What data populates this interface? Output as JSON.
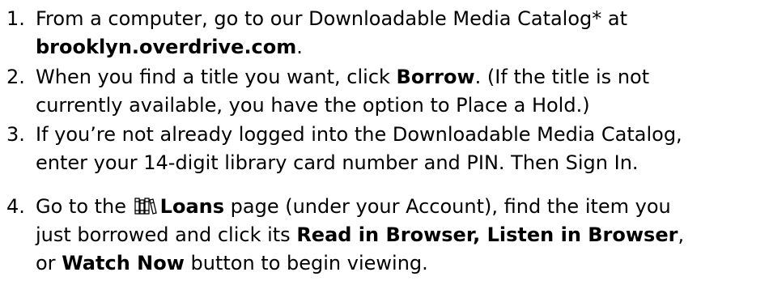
{
  "steps": [
    {
      "number": "1.",
      "line1_text": "From a computer, go to our Downloadable Media Catalog* at",
      "line2_bold": "brooklyn.overdrive.com",
      "line2_text": "."
    },
    {
      "number": "2.",
      "line1_text": "When you find a title you want, click ",
      "line1_bold": "Borrow",
      "line1_tail": ". (If the title is not",
      "line2_text": "currently available, you have the option to Place a Hold.)"
    },
    {
      "number": "3.",
      "line1_text": "If you’re not already logged into the Downloadable Media Catalog,",
      "line2_text": "enter your 14-digit library card number and PIN. Then Sign In."
    },
    {
      "number": "4.",
      "line1_text": "Go to the ",
      "line1_icon": "bookshelf-icon",
      "line1_bold": "Loans",
      "line1_tail": " page (under your Account), find the item you",
      "line2_text": "just borrowed and click its ",
      "line2_bold": "Read in Browser, Listen in Browser",
      "line2_tail": ",",
      "line3_text": "or ",
      "line3_bold": "Watch Now",
      "line3_tail": " button to begin viewing."
    }
  ]
}
